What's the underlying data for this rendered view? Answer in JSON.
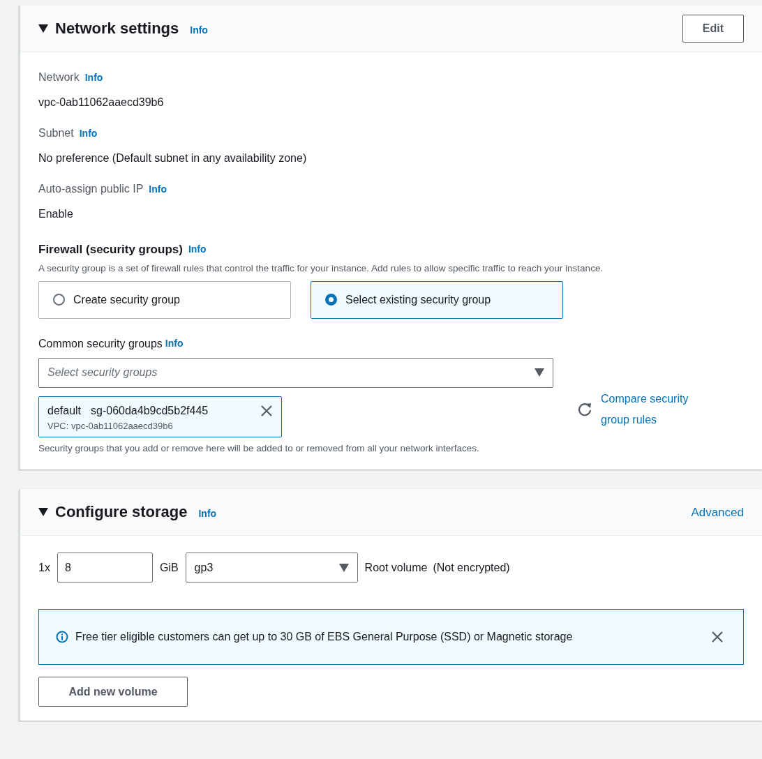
{
  "network_settings": {
    "title": "Network settings",
    "info": "Info",
    "expanded": true,
    "edit_button": "Edit",
    "fields": [
      {
        "label": "Network",
        "info": "Info",
        "value": "vpc-0ab11062aaecd39b6"
      },
      {
        "label": "Subnet",
        "info": "Info",
        "value": "No preference (Default subnet in any availability zone)"
      },
      {
        "label": "Auto-assign public IP",
        "info": "Info",
        "value": "Enable"
      }
    ],
    "firewall": {
      "title": "Firewall (security groups)",
      "info": "Info",
      "description": "A security group is a set of firewall rules that control the traffic for your instance. Add rules to allow specific traffic to reach your instance.",
      "options": [
        {
          "label": "Create security group",
          "selected": false
        },
        {
          "label": "Select existing security group",
          "selected": true
        }
      ],
      "common_groups": {
        "label": "Common security groups",
        "info": "Info",
        "placeholder": "Select security groups"
      },
      "selected_groups": [
        {
          "name": "default",
          "id": "sg-060da4b9cd5b2f445",
          "vpc": "VPC: vpc-0ab11062aaecd39b6"
        }
      ],
      "compare_link": "Compare security group rules",
      "note": "Security groups that you add or remove here will be added to or removed from all your network interfaces."
    }
  },
  "configure_storage": {
    "title": "Configure storage",
    "info": "Info",
    "expanded": true,
    "advanced_link": "Advanced",
    "volume": {
      "count": "1x",
      "size": "8",
      "unit": "GiB",
      "type": "gp3",
      "name": "Root volume",
      "encryption": "(Not encrypted)"
    },
    "alert": {
      "text": "Free tier eligible customers can get up to 30 GB of EBS General Purpose (SSD) or Magnetic storage"
    },
    "add_button": "Add new volume"
  }
}
